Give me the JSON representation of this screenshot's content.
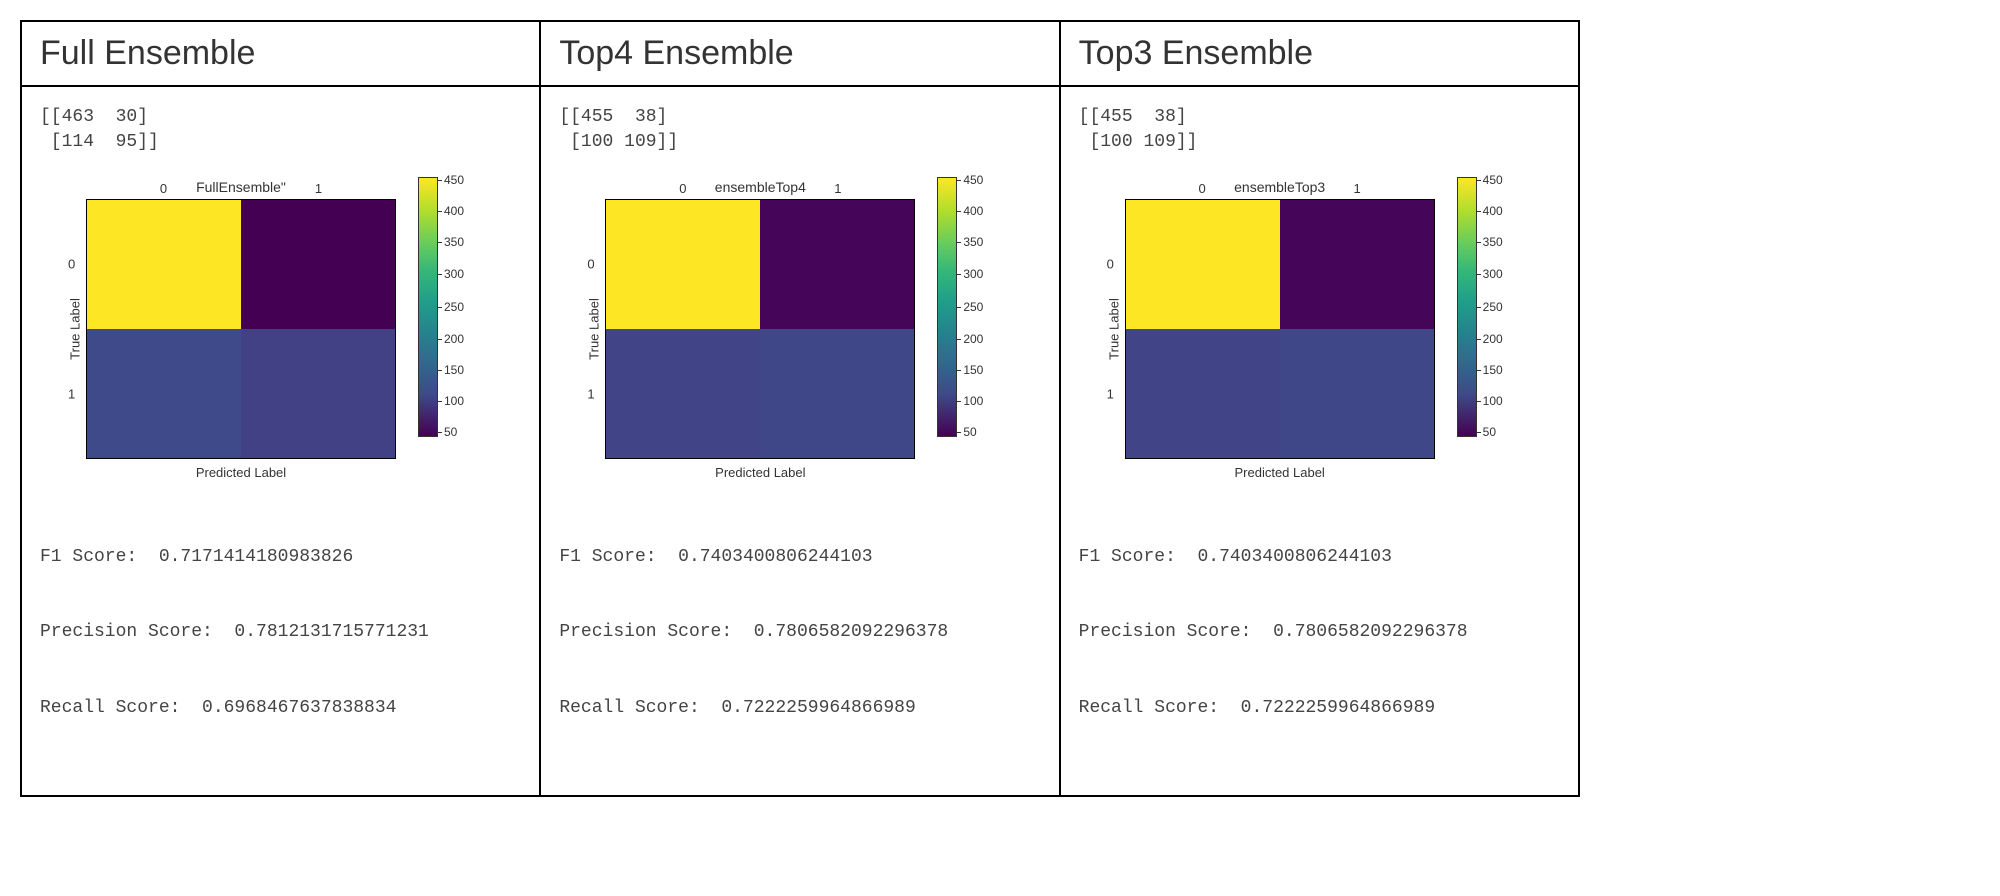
{
  "chart_data": [
    {
      "type": "heatmap",
      "panel_title": "Full Ensemble",
      "matrix_text": "[[463  30]\n [114  95]]",
      "title": "FullEnsemble\"",
      "xlabel": "Predicted Label",
      "ylabel": "True Label",
      "x_categories": [
        "0",
        "1"
      ],
      "y_categories": [
        "0",
        "1"
      ],
      "values": [
        [
          463,
          30
        ],
        [
          114,
          95
        ]
      ],
      "color_range": [
        50,
        450
      ],
      "colorbar_ticks": [
        "450",
        "400",
        "350",
        "300",
        "250",
        "200",
        "150",
        "100",
        "50"
      ],
      "f1": "F1 Score:  0.7171414180983826",
      "precision": "Precision Score:  0.7812131715771231",
      "recall": "Recall Score:  0.6968467637838834",
      "cell_colors": [
        "#fde725",
        "#440154",
        "#3e4a89",
        "#424186"
      ]
    },
    {
      "type": "heatmap",
      "panel_title": "Top4 Ensemble",
      "matrix_text": "[[455  38]\n [100 109]]",
      "title": "ensembleTop4",
      "xlabel": "Predicted Label",
      "ylabel": "True Label",
      "x_categories": [
        "0",
        "1"
      ],
      "y_categories": [
        "0",
        "1"
      ],
      "values": [
        [
          455,
          38
        ],
        [
          100,
          109
        ]
      ],
      "color_range": [
        50,
        450
      ],
      "colorbar_ticks": [
        "450",
        "400",
        "350",
        "300",
        "250",
        "200",
        "150",
        "100",
        "50"
      ],
      "f1": "F1 Score:  0.7403400806244103",
      "precision": "Precision Score:  0.7806582092296378",
      "recall": "Recall Score:  0.7222259964866989",
      "cell_colors": [
        "#fde725",
        "#450559",
        "#414487",
        "#3f4788"
      ]
    },
    {
      "type": "heatmap",
      "panel_title": "Top3 Ensemble",
      "matrix_text": "[[455  38]\n [100 109]]",
      "title": "ensembleTop3",
      "xlabel": "Predicted Label",
      "ylabel": "True Label",
      "x_categories": [
        "0",
        "1"
      ],
      "y_categories": [
        "0",
        "1"
      ],
      "values": [
        [
          455,
          38
        ],
        [
          100,
          109
        ]
      ],
      "color_range": [
        50,
        450
      ],
      "colorbar_ticks": [
        "450",
        "400",
        "350",
        "300",
        "250",
        "200",
        "150",
        "100",
        "50"
      ],
      "f1": "F1 Score:  0.7403400806244103",
      "precision": "Precision Score:  0.7806582092296378",
      "recall": "Recall Score:  0.7222259964866989",
      "cell_colors": [
        "#fde725",
        "#450559",
        "#414487",
        "#3f4788"
      ]
    }
  ]
}
